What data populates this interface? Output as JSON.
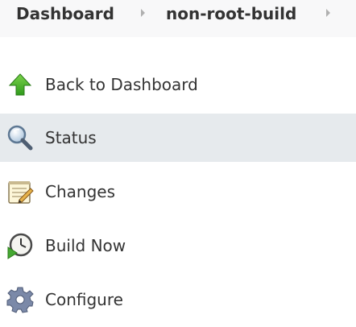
{
  "breadcrumb": {
    "items": [
      {
        "label": "Dashboard"
      },
      {
        "label": "non-root-build"
      }
    ]
  },
  "tasks": [
    {
      "label": "Back to Dashboard",
      "icon": "up-arrow-icon",
      "active": false
    },
    {
      "label": "Status",
      "icon": "search-icon",
      "active": true
    },
    {
      "label": "Changes",
      "icon": "notepad-icon",
      "active": false
    },
    {
      "label": "Build Now",
      "icon": "clock-play-icon",
      "active": false
    },
    {
      "label": "Configure",
      "icon": "gear-icon",
      "active": false
    }
  ],
  "colors": {
    "breadcrumb_bg": "#f8f8f9",
    "active_bg": "#e6eaed",
    "text": "#333333",
    "chevron": "#b0b0b0"
  }
}
